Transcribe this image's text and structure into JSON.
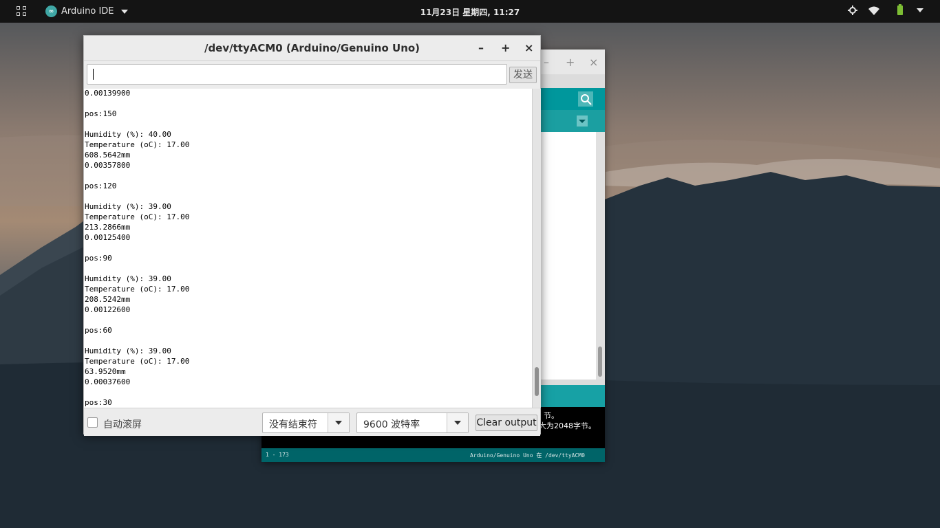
{
  "topbar": {
    "activities_icon": "apps-grid-icon",
    "app_name": "Arduino IDE",
    "app_logo_text": "∞",
    "clock": "11月23日 星期四, 11:27",
    "tray_icons": [
      "location-icon",
      "wifi-icon",
      "battery-icon",
      "system-menu-icon"
    ]
  },
  "ide_window": {
    "window_buttons": {
      "minimize": "–",
      "maximize": "+",
      "close": "×"
    },
    "console_lines": [
      "节。",
      "大为2048字节。"
    ],
    "status_left": "1 - 173",
    "status_right": "Arduino/Genuino Uno 在 /dev/ttyACM0",
    "accent_color": "#00979c"
  },
  "serial_monitor": {
    "title": "/dev/ttyACM0 (Arduino/Genuino Uno)",
    "window_buttons": {
      "minimize": "–",
      "maximize": "+",
      "close": "×"
    },
    "send_input_value": "",
    "send_label": "发送",
    "output_lines": [
      "0.00139900",
      "",
      "pos:150",
      "",
      "Humidity (%): 40.00",
      "Temperature (oC): 17.00",
      "608.5642mm",
      "0.00357800",
      "",
      "pos:120",
      "",
      "Humidity (%): 39.00",
      "Temperature (oC): 17.00",
      "213.2866mm",
      "0.00125400",
      "",
      "pos:90",
      "",
      "Humidity (%): 39.00",
      "Temperature (oC): 17.00",
      "208.5242mm",
      "0.00122600",
      "",
      "pos:60",
      "",
      "Humidity (%): 39.00",
      "Temperature (oC): 17.00",
      "63.9520mm",
      "0.00037600",
      "",
      "pos:30"
    ],
    "autoscroll_label": "自动滚屏",
    "autoscroll_checked": false,
    "line_ending_selected": "没有结束符",
    "baud_selected": "9600 波特率",
    "clear_label": "Clear output"
  }
}
